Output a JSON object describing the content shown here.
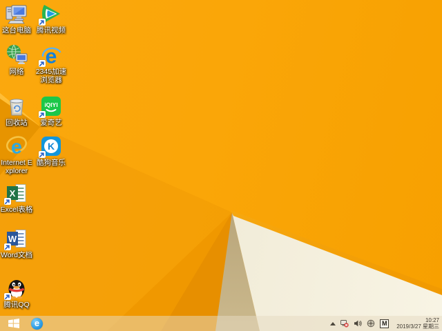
{
  "desktop": {
    "icons": [
      {
        "id": "this-pc",
        "label": "这台电脑",
        "col": 0,
        "row": 0,
        "shortcut": false
      },
      {
        "id": "tencent-video",
        "label": "腾讯视频",
        "col": 1,
        "row": 0,
        "shortcut": true
      },
      {
        "id": "network",
        "label": "网络",
        "col": 0,
        "row": 1,
        "shortcut": false
      },
      {
        "id": "browser-2345",
        "label": "2345加速浏览器",
        "col": 1,
        "row": 1,
        "shortcut": true
      },
      {
        "id": "recycle-bin",
        "label": "回收站",
        "col": 0,
        "row": 2,
        "shortcut": false
      },
      {
        "id": "iqiyi",
        "label": "爱奇艺",
        "col": 1,
        "row": 2,
        "shortcut": true
      },
      {
        "id": "internet-explorer",
        "label": "Internet Explorer",
        "col": 0,
        "row": 3,
        "shortcut": false
      },
      {
        "id": "kugou-music",
        "label": "酷狗音乐",
        "col": 1,
        "row": 3,
        "shortcut": true
      },
      {
        "id": "excel",
        "label": "Excel表格",
        "col": 0,
        "row": 4,
        "shortcut": true
      },
      {
        "id": "word",
        "label": "Word文档",
        "col": 0,
        "row": 5,
        "shortcut": true
      },
      {
        "id": "qq",
        "label": "腾讯QQ",
        "col": 0,
        "row": 6,
        "shortcut": true
      }
    ]
  },
  "glyphs": {
    "iqiyi": "iQIYI",
    "kugou": "K",
    "excel": "X",
    "word": "W",
    "ie": "e",
    "browser2345": "e",
    "taskbar_ie": "e"
  },
  "taskbar": {
    "tray": {
      "ime_badge": "M",
      "clock": {
        "time": "10:27",
        "date": "2019/3/27 星期三"
      }
    },
    "icon_names": [
      "start-button",
      "ie-taskbar-icon",
      "hidden-icons-arrow",
      "network-error-icon",
      "volume-icon",
      "utility-circle-icon",
      "ime-indicator",
      "clock"
    ]
  },
  "colors": {
    "wallpaper_orange": "#F8A303",
    "wallpaper_fold": "#E79400",
    "wallpaper_tan": "#B5A176",
    "wallpaper_cream": "#F3EEDA",
    "taskbar_tint": "rgba(231,219,193,0.52)",
    "iqiyi_green": "#1CC749",
    "kugou_blue": "#1296DB",
    "excel_green": "#217346",
    "word_blue": "#2B579A",
    "qq_scarf_red": "#E23C3C",
    "ie_blue": "#2EA9E0"
  }
}
